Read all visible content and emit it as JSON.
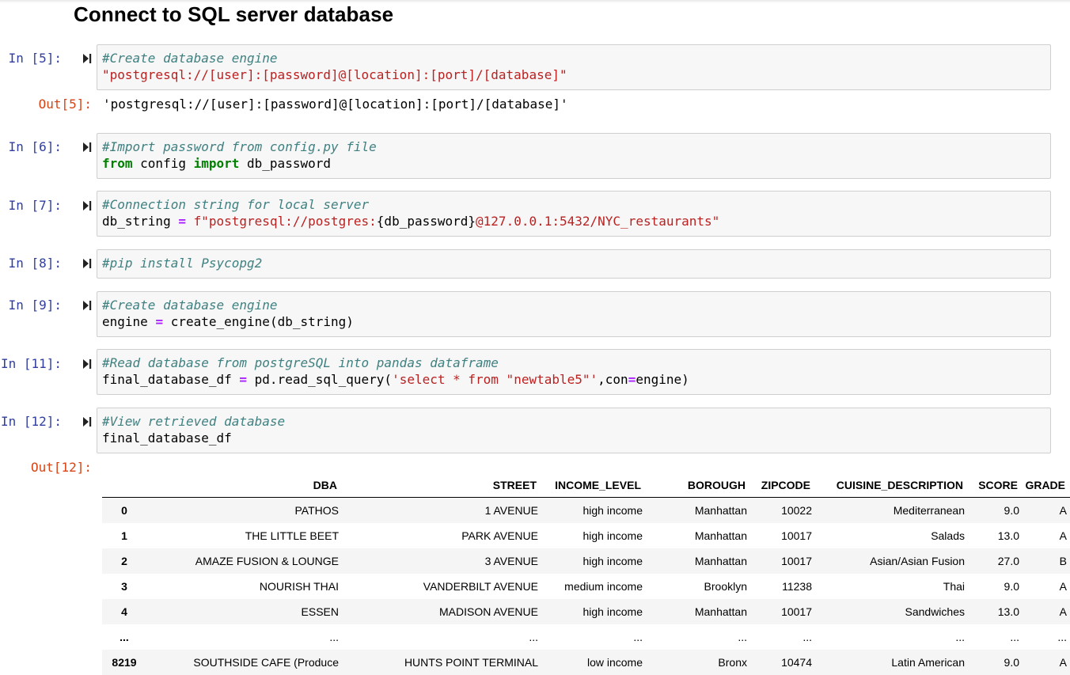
{
  "heading": "Connect to SQL server database",
  "cells": [
    {
      "prompt": "In [5]:",
      "lines": [
        [
          {
            "t": "cm",
            "v": "#Create database engine"
          }
        ],
        [
          {
            "t": "str",
            "v": "\"postgresql://[user]:[password]@[location]:[port]/[database]\""
          }
        ]
      ],
      "out_prompt": "Out[5]:",
      "output": "'postgresql://[user]:[password]@[location]:[port]/[database]'"
    },
    {
      "prompt": "In [6]:",
      "lines": [
        [
          {
            "t": "cm",
            "v": "#Import password from config.py file"
          }
        ],
        [
          {
            "t": "kw",
            "v": "from"
          },
          {
            "t": "",
            "v": " config "
          },
          {
            "t": "kw",
            "v": "import"
          },
          {
            "t": "",
            "v": " db_password"
          }
        ]
      ]
    },
    {
      "prompt": "In [7]:",
      "lines": [
        [
          {
            "t": "cm",
            "v": "#Connection string for local server"
          }
        ],
        [
          {
            "t": "",
            "v": "db_string "
          },
          {
            "t": "op",
            "v": "="
          },
          {
            "t": "",
            "v": " "
          },
          {
            "t": "str",
            "v": "f\"postgresql://postgres:"
          },
          {
            "t": "",
            "v": "{db_password}"
          },
          {
            "t": "str",
            "v": "@127.0.0.1:5432/NYC_restaurants\""
          }
        ]
      ]
    },
    {
      "prompt": "In [8]:",
      "lines": [
        [
          {
            "t": "cm",
            "v": "#pip install Psycopg2"
          }
        ]
      ]
    },
    {
      "prompt": "In [9]:",
      "lines": [
        [
          {
            "t": "cm",
            "v": "#Create database engine"
          }
        ],
        [
          {
            "t": "",
            "v": "engine "
          },
          {
            "t": "op",
            "v": "="
          },
          {
            "t": "",
            "v": " create_engine(db_string)"
          }
        ]
      ]
    },
    {
      "prompt": "In [11]:",
      "lines": [
        [
          {
            "t": "cm",
            "v": "#Read database from postgreSQL into pandas dataframe"
          }
        ],
        [
          {
            "t": "",
            "v": "final_database_df "
          },
          {
            "t": "op",
            "v": "="
          },
          {
            "t": "",
            "v": " pd.read_sql_query("
          },
          {
            "t": "str",
            "v": "'select * from \"newtable5\"'"
          },
          {
            "t": "",
            "v": ",con"
          },
          {
            "t": "op",
            "v": "="
          },
          {
            "t": "",
            "v": "engine)"
          }
        ]
      ]
    },
    {
      "prompt": "In [12]:",
      "lines": [
        [
          {
            "t": "cm",
            "v": "#View retrieved database"
          }
        ],
        [
          {
            "t": "",
            "v": "final_database_df"
          }
        ]
      ],
      "out_prompt": "Out[12]:"
    }
  ],
  "dataframe": {
    "columns": [
      "",
      "DBA",
      "STREET",
      "INCOME_LEVEL",
      "BOROUGH",
      "ZIPCODE",
      "CUISINE_DESCRIPTION",
      "SCORE",
      "GRADE"
    ],
    "rows": [
      [
        "0",
        "PATHOS",
        "1 AVENUE",
        "high income",
        "Manhattan",
        "10022",
        "Mediterranean",
        "9.0",
        "A"
      ],
      [
        "1",
        "THE LITTLE BEET",
        "PARK AVENUE",
        "high income",
        "Manhattan",
        "10017",
        "Salads",
        "13.0",
        "A"
      ],
      [
        "2",
        "AMAZE FUSION & LOUNGE",
        "3 AVENUE",
        "high income",
        "Manhattan",
        "10017",
        "Asian/Asian Fusion",
        "27.0",
        "B"
      ],
      [
        "3",
        "NOURISH THAI",
        "VANDERBILT AVENUE",
        "medium income",
        "Brooklyn",
        "11238",
        "Thai",
        "9.0",
        "A"
      ],
      [
        "4",
        "ESSEN",
        "MADISON AVENUE",
        "high income",
        "Manhattan",
        "10017",
        "Sandwiches",
        "13.0",
        "A"
      ],
      [
        "...",
        "...",
        "...",
        "...",
        "...",
        "...",
        "...",
        "...",
        "..."
      ],
      [
        "8219",
        "SOUTHSIDE CAFE (Produce",
        "HUNTS POINT TERMINAL",
        "low income",
        "Bronx",
        "10474",
        "Latin American",
        "9.0",
        "A"
      ]
    ]
  }
}
